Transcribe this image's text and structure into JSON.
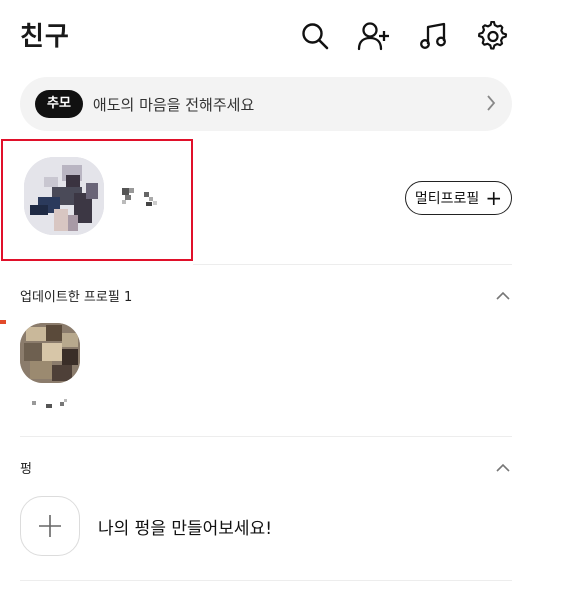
{
  "header": {
    "title": "친구",
    "icons": [
      "search-icon",
      "add-friend-icon",
      "music-icon",
      "settings-icon"
    ]
  },
  "banner": {
    "badge": "추모",
    "text": "애도의 마음을 전해주세요"
  },
  "profile": {
    "multi_profile_label": "멀티프로필"
  },
  "updated_section": {
    "label": "업데이트한 프로필 1"
  },
  "pyeong_section": {
    "label": "펑",
    "create_text": "나의 펑을 만들어보세요!"
  },
  "colors": {
    "accent_highlight": "#e0102a",
    "badge_bg": "#111111",
    "banner_bg": "#f3f3f3"
  }
}
